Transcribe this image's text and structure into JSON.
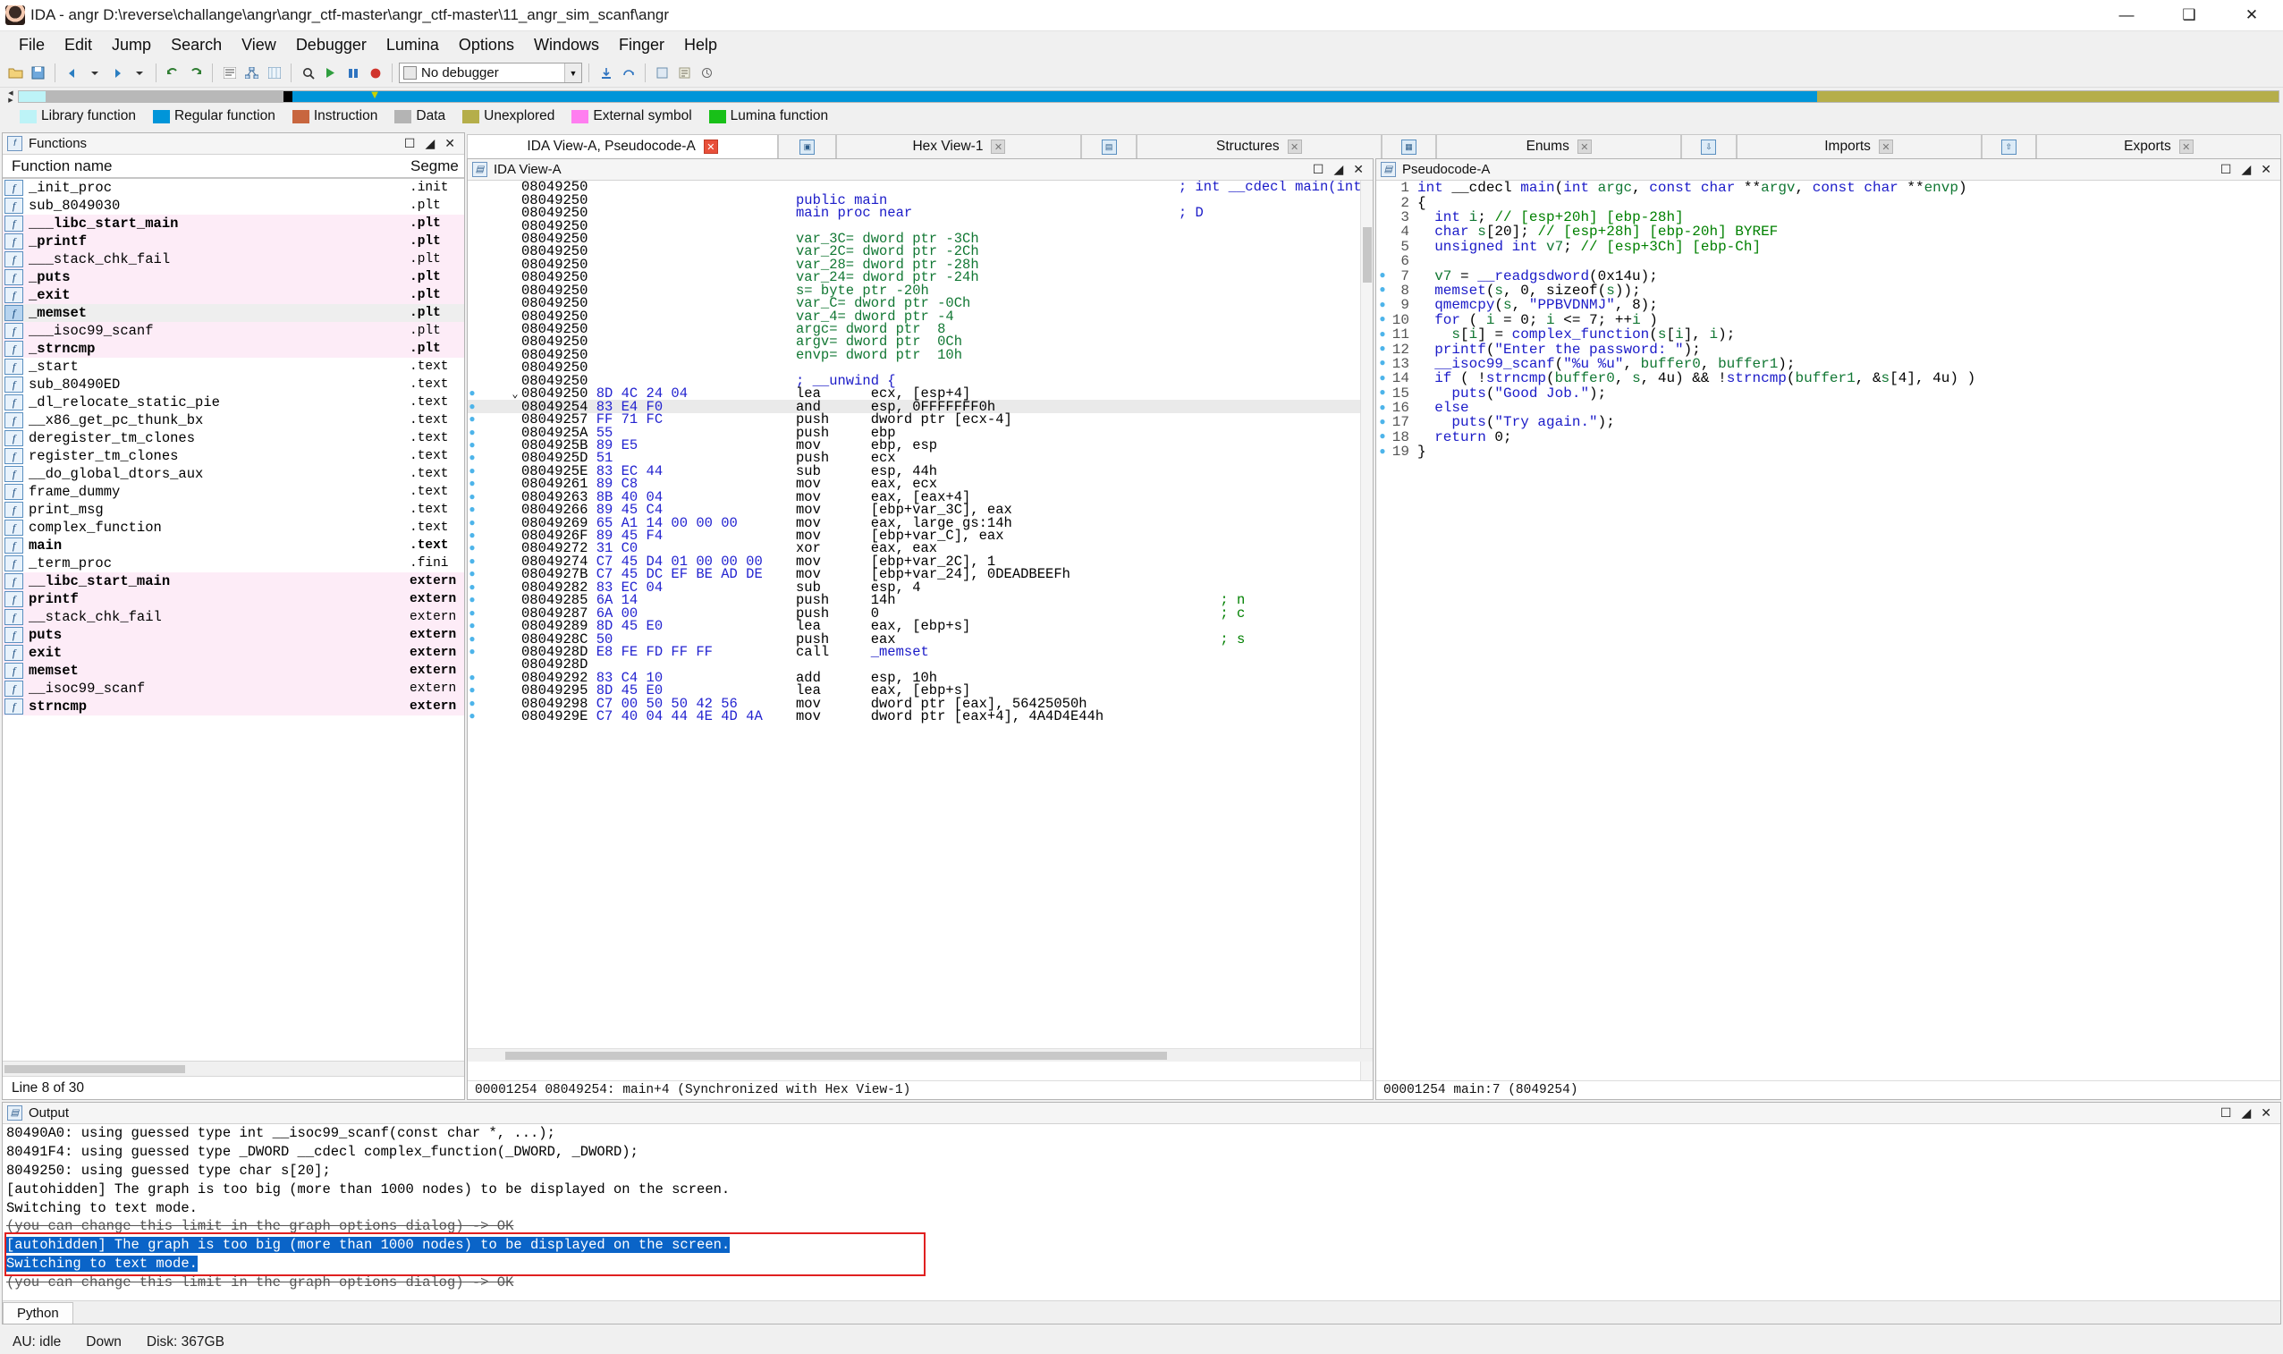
{
  "window": {
    "title": "IDA - angr D:\\reverse\\challange\\angr\\angr_ctf-master\\angr_ctf-master\\11_angr_sim_scanf\\angr",
    "minimize": "—",
    "maximize": "❑",
    "close": "✕"
  },
  "menu": [
    "File",
    "Edit",
    "Jump",
    "Search",
    "View",
    "Debugger",
    "Lumina",
    "Options",
    "Windows",
    "Finger",
    "Help"
  ],
  "toolbar": {
    "debugger_value": "No debugger",
    "icons": [
      "open-icon",
      "save-icon",
      "back-icon",
      "forward-icon",
      "undo-icon",
      "redo-icon",
      "text-view-icon",
      "graph-icon",
      "hex-icon",
      "search-icon",
      "run-icon",
      "pause-icon",
      "stop-icon"
    ]
  },
  "legend": [
    {
      "label": "Library function",
      "color": "#bdf3f7"
    },
    {
      "label": "Regular function",
      "color": "#0095d9"
    },
    {
      "label": "Instruction",
      "color": "#c8663f"
    },
    {
      "label": "Data",
      "color": "#b4b4b4"
    },
    {
      "label": "Unexplored",
      "color": "#b5ae4a"
    },
    {
      "label": "External symbol",
      "color": "#ff7ef0"
    },
    {
      "label": "Lumina function",
      "color": "#18c018"
    }
  ],
  "tabs_left": [
    {
      "label": "IDA View-A, Pseudocode-A",
      "closable": true,
      "active": true,
      "icon": null
    },
    {
      "label": "",
      "closable": false,
      "active": false,
      "icon": "window-icon"
    },
    {
      "label": "Hex View-1",
      "closable": true,
      "active": false,
      "icon": null
    },
    {
      "label": "",
      "closable": false,
      "active": false,
      "icon": "struct-icon"
    },
    {
      "label": "Structures",
      "closable": true,
      "active": false,
      "icon": null
    },
    {
      "label": "",
      "closable": false,
      "active": false,
      "icon": "enums-icon"
    },
    {
      "label": "Enums",
      "closable": true,
      "active": false,
      "icon": null
    },
    {
      "label": "",
      "closable": false,
      "active": false,
      "icon": "imports-icon"
    },
    {
      "label": "Imports",
      "closable": true,
      "active": false,
      "icon": null
    },
    {
      "label": "",
      "closable": false,
      "active": false,
      "icon": "exports-icon"
    },
    {
      "label": "Exports",
      "closable": true,
      "active": false,
      "icon": null
    }
  ],
  "functions_panel": {
    "title": "Functions",
    "columns": [
      "Function name",
      "Segme"
    ],
    "status": "Line 8 of 30",
    "rows": [
      {
        "name": "_init_proc",
        "segment": ".init",
        "lib": false,
        "selected": false,
        "bold": false
      },
      {
        "name": "sub_8049030",
        "segment": ".plt",
        "lib": false,
        "selected": false,
        "bold": false
      },
      {
        "name": "___libc_start_main",
        "segment": ".plt",
        "lib": true,
        "selected": false,
        "bold": true
      },
      {
        "name": "_printf",
        "segment": ".plt",
        "lib": true,
        "selected": false,
        "bold": true
      },
      {
        "name": "___stack_chk_fail",
        "segment": ".plt",
        "lib": true,
        "selected": false,
        "bold": false
      },
      {
        "name": "_puts",
        "segment": ".plt",
        "lib": true,
        "selected": false,
        "bold": true
      },
      {
        "name": "_exit",
        "segment": ".plt",
        "lib": true,
        "selected": false,
        "bold": true
      },
      {
        "name": "_memset",
        "segment": ".plt",
        "lib": true,
        "selected": true,
        "bold": true
      },
      {
        "name": "___isoc99_scanf",
        "segment": ".plt",
        "lib": true,
        "selected": false,
        "bold": false
      },
      {
        "name": "_strncmp",
        "segment": ".plt",
        "lib": true,
        "selected": false,
        "bold": true
      },
      {
        "name": "_start",
        "segment": ".text",
        "lib": false,
        "selected": false,
        "bold": false
      },
      {
        "name": "sub_80490ED",
        "segment": ".text",
        "lib": false,
        "selected": false,
        "bold": false
      },
      {
        "name": "_dl_relocate_static_pie",
        "segment": ".text",
        "lib": false,
        "selected": false,
        "bold": false
      },
      {
        "name": "__x86_get_pc_thunk_bx",
        "segment": ".text",
        "lib": false,
        "selected": false,
        "bold": false
      },
      {
        "name": "deregister_tm_clones",
        "segment": ".text",
        "lib": false,
        "selected": false,
        "bold": false
      },
      {
        "name": "register_tm_clones",
        "segment": ".text",
        "lib": false,
        "selected": false,
        "bold": false
      },
      {
        "name": "__do_global_dtors_aux",
        "segment": ".text",
        "lib": false,
        "selected": false,
        "bold": false
      },
      {
        "name": "frame_dummy",
        "segment": ".text",
        "lib": false,
        "selected": false,
        "bold": false
      },
      {
        "name": "print_msg",
        "segment": ".text",
        "lib": false,
        "selected": false,
        "bold": false
      },
      {
        "name": "complex_function",
        "segment": ".text",
        "lib": false,
        "selected": false,
        "bold": false
      },
      {
        "name": "main",
        "segment": ".text",
        "lib": false,
        "selected": false,
        "bold": true
      },
      {
        "name": "_term_proc",
        "segment": ".fini",
        "lib": false,
        "selected": false,
        "bold": false
      },
      {
        "name": "__libc_start_main",
        "segment": "extern",
        "lib": true,
        "selected": false,
        "bold": true
      },
      {
        "name": "printf",
        "segment": "extern",
        "lib": true,
        "selected": false,
        "bold": true
      },
      {
        "name": "__stack_chk_fail",
        "segment": "extern",
        "lib": true,
        "selected": false,
        "bold": false
      },
      {
        "name": "puts",
        "segment": "extern",
        "lib": true,
        "selected": false,
        "bold": true
      },
      {
        "name": "exit",
        "segment": "extern",
        "lib": true,
        "selected": false,
        "bold": true
      },
      {
        "name": "memset",
        "segment": "extern",
        "lib": true,
        "selected": false,
        "bold": true
      },
      {
        "name": "__isoc99_scanf",
        "segment": "extern",
        "lib": true,
        "selected": false,
        "bold": false
      },
      {
        "name": "strncmp",
        "segment": "extern",
        "lib": true,
        "selected": false,
        "bold": true
      }
    ]
  },
  "idaview": {
    "title": "IDA View-A",
    "status": "00001254 08049254: main+4 (Synchronized with Hex View-1)",
    "lines": [
      {
        "dot": false,
        "arrow": "",
        "addr": "08049250",
        "bytes": "",
        "mnem": "",
        "op": "",
        "cmt": "; int __cdecl main(int argc, const char **a",
        "cmt_color": "blue",
        "hl": false
      },
      {
        "dot": false,
        "arrow": "",
        "addr": "08049250",
        "bytes": "",
        "mnem": "public main",
        "op": "",
        "cmt": "",
        "mnem_color": "blue",
        "hl": false
      },
      {
        "dot": false,
        "arrow": "",
        "addr": "08049250",
        "bytes": "",
        "mnem": "main proc near",
        "op": "",
        "cmt": "; D",
        "mnem_color": "blue",
        "cmt_color": "blue",
        "hl": false
      },
      {
        "dot": false,
        "arrow": "",
        "addr": "08049250",
        "bytes": "",
        "mnem": "",
        "op": "",
        "cmt": "",
        "hl": false
      },
      {
        "dot": false,
        "arrow": "",
        "addr": "08049250",
        "bytes": "",
        "mnem": "var_3C= dword ptr -3Ch",
        "op": "",
        "cmt": "",
        "mnem_color": "green",
        "hl": false
      },
      {
        "dot": false,
        "arrow": "",
        "addr": "08049250",
        "bytes": "",
        "mnem": "var_2C= dword ptr -2Ch",
        "op": "",
        "cmt": "",
        "mnem_color": "green",
        "hl": false
      },
      {
        "dot": false,
        "arrow": "",
        "addr": "08049250",
        "bytes": "",
        "mnem": "var_28= dword ptr -28h",
        "op": "",
        "cmt": "",
        "mnem_color": "green",
        "hl": false
      },
      {
        "dot": false,
        "arrow": "",
        "addr": "08049250",
        "bytes": "",
        "mnem": "var_24= dword ptr -24h",
        "op": "",
        "cmt": "",
        "mnem_color": "green",
        "hl": false
      },
      {
        "dot": false,
        "arrow": "",
        "addr": "08049250",
        "bytes": "",
        "mnem": "s= byte ptr -20h",
        "op": "",
        "cmt": "",
        "mnem_color": "green",
        "hl": false
      },
      {
        "dot": false,
        "arrow": "",
        "addr": "08049250",
        "bytes": "",
        "mnem": "var_C= dword ptr -0Ch",
        "op": "",
        "cmt": "",
        "mnem_color": "green",
        "hl": false
      },
      {
        "dot": false,
        "arrow": "",
        "addr": "08049250",
        "bytes": "",
        "mnem": "var_4= dword ptr -4",
        "op": "",
        "cmt": "",
        "mnem_color": "green",
        "hl": false
      },
      {
        "dot": false,
        "arrow": "",
        "addr": "08049250",
        "bytes": "",
        "mnem": "argc= dword ptr  8",
        "op": "",
        "cmt": "",
        "mnem_color": "green",
        "hl": false
      },
      {
        "dot": false,
        "arrow": "",
        "addr": "08049250",
        "bytes": "",
        "mnem": "argv= dword ptr  0Ch",
        "op": "",
        "cmt": "",
        "mnem_color": "green",
        "hl": false
      },
      {
        "dot": false,
        "arrow": "",
        "addr": "08049250",
        "bytes": "",
        "mnem": "envp= dword ptr  10h",
        "op": "",
        "cmt": "",
        "mnem_color": "green",
        "hl": false
      },
      {
        "dot": false,
        "arrow": "",
        "addr": "08049250",
        "bytes": "",
        "mnem": "",
        "op": "",
        "cmt": "",
        "hl": false
      },
      {
        "dot": false,
        "arrow": "",
        "addr": "08049250",
        "bytes": "",
        "mnem": "; __unwind {",
        "op": "",
        "cmt": "",
        "mnem_color": "blue",
        "hl": false
      },
      {
        "dot": true,
        "arrow": "v",
        "addr": "08049250",
        "bytes": "8D 4C 24 04",
        "mnem": "lea",
        "op": "ecx, [esp+4]",
        "cmt": "",
        "hl": false
      },
      {
        "dot": true,
        "arrow": "",
        "addr": "08049254",
        "bytes": "83 E4 F0",
        "mnem": "and",
        "op": "esp, 0FFFFFFF0h",
        "cmt": "",
        "hl": true
      },
      {
        "dot": true,
        "arrow": "",
        "addr": "08049257",
        "bytes": "FF 71 FC",
        "mnem": "push",
        "op": "dword ptr [ecx-4]",
        "cmt": "",
        "hl": false
      },
      {
        "dot": true,
        "arrow": "",
        "addr": "0804925A",
        "bytes": "55",
        "mnem": "push",
        "op": "ebp",
        "cmt": "",
        "hl": false
      },
      {
        "dot": true,
        "arrow": "",
        "addr": "0804925B",
        "bytes": "89 E5",
        "mnem": "mov",
        "op": "ebp, esp",
        "cmt": "",
        "hl": false
      },
      {
        "dot": true,
        "arrow": "",
        "addr": "0804925D",
        "bytes": "51",
        "mnem": "push",
        "op": "ecx",
        "cmt": "",
        "hl": false
      },
      {
        "dot": true,
        "arrow": "",
        "addr": "0804925E",
        "bytes": "83 EC 44",
        "mnem": "sub",
        "op": "esp, 44h",
        "cmt": "",
        "hl": false
      },
      {
        "dot": true,
        "arrow": "",
        "addr": "08049261",
        "bytes": "89 C8",
        "mnem": "mov",
        "op": "eax, ecx",
        "cmt": "",
        "hl": false
      },
      {
        "dot": true,
        "arrow": "",
        "addr": "08049263",
        "bytes": "8B 40 04",
        "mnem": "mov",
        "op": "eax, [eax+4]",
        "cmt": "",
        "hl": false
      },
      {
        "dot": true,
        "arrow": "",
        "addr": "08049266",
        "bytes": "89 45 C4",
        "mnem": "mov",
        "op": "[ebp+var_3C], eax",
        "cmt": "",
        "hl": false
      },
      {
        "dot": true,
        "arrow": "",
        "addr": "08049269",
        "bytes": "65 A1 14 00 00 00",
        "mnem": "mov",
        "op": "eax, large gs:14h",
        "cmt": "",
        "hl": false
      },
      {
        "dot": true,
        "arrow": "",
        "addr": "0804926F",
        "bytes": "89 45 F4",
        "mnem": "mov",
        "op": "[ebp+var_C], eax",
        "cmt": "",
        "hl": false
      },
      {
        "dot": true,
        "arrow": "",
        "addr": "08049272",
        "bytes": "31 C0",
        "mnem": "xor",
        "op": "eax, eax",
        "cmt": "",
        "hl": false
      },
      {
        "dot": true,
        "arrow": "",
        "addr": "08049274",
        "bytes": "C7 45 D4 01 00 00 00",
        "mnem": "mov",
        "op": "[ebp+var_2C], 1",
        "cmt": "",
        "hl": false
      },
      {
        "dot": true,
        "arrow": "",
        "addr": "0804927B",
        "bytes": "C7 45 DC EF BE AD DE",
        "mnem": "mov",
        "op": "[ebp+var_24], 0DEADBEEFh",
        "cmt": "",
        "hl": false
      },
      {
        "dot": true,
        "arrow": "",
        "addr": "08049282",
        "bytes": "83 EC 04",
        "mnem": "sub",
        "op": "esp, 4",
        "cmt": "",
        "hl": false
      },
      {
        "dot": true,
        "arrow": "",
        "addr": "08049285",
        "bytes": "6A 14",
        "mnem": "push",
        "op": "14h",
        "cmt": "; n",
        "hl": false
      },
      {
        "dot": true,
        "arrow": "",
        "addr": "08049287",
        "bytes": "6A 00",
        "mnem": "push",
        "op": "0",
        "cmt": "; c",
        "hl": false
      },
      {
        "dot": true,
        "arrow": "",
        "addr": "08049289",
        "bytes": "8D 45 E0",
        "mnem": "lea",
        "op": "eax, [ebp+s]",
        "cmt": "",
        "hl": false
      },
      {
        "dot": true,
        "arrow": "",
        "addr": "0804928C",
        "bytes": "50",
        "mnem": "push",
        "op": "eax",
        "cmt": "; s",
        "hl": false
      },
      {
        "dot": true,
        "arrow": "",
        "addr": "0804928D",
        "bytes": "E8 FE FD FF FF",
        "mnem": "call",
        "op": "_memset",
        "cmt": "",
        "op_color": "blue",
        "hl": false
      },
      {
        "dot": false,
        "arrow": "",
        "addr": "0804928D",
        "bytes": "",
        "mnem": "",
        "op": "",
        "cmt": "",
        "hl": false
      },
      {
        "dot": true,
        "arrow": "",
        "addr": "08049292",
        "bytes": "83 C4 10",
        "mnem": "add",
        "op": "esp, 10h",
        "cmt": "",
        "hl": false
      },
      {
        "dot": true,
        "arrow": "",
        "addr": "08049295",
        "bytes": "8D 45 E0",
        "mnem": "lea",
        "op": "eax, [ebp+s]",
        "cmt": "",
        "hl": false
      },
      {
        "dot": true,
        "arrow": "",
        "addr": "08049298",
        "bytes": "C7 00 50 50 42 56",
        "mnem": "mov",
        "op": "dword ptr [eax], 56425050h",
        "cmt": "",
        "hl": false
      },
      {
        "dot": true,
        "arrow": "",
        "addr": "0804929E",
        "bytes": "C7 40 04 44 4E 4D 4A",
        "mnem": "mov",
        "op": "dword ptr [eax+4], 4A4D4E44h",
        "cmt": "",
        "hl": false
      }
    ]
  },
  "pseudocode": {
    "title": "Pseudocode-A",
    "status": "00001254 main:7 (8049254)",
    "lines": [
      {
        "n": 1,
        "dot": false,
        "text": "int __cdecl main(int argc, const char **argv, const char **envp)"
      },
      {
        "n": 2,
        "dot": false,
        "text": "{"
      },
      {
        "n": 3,
        "dot": false,
        "text": "  int i; // [esp+20h] [ebp-28h]"
      },
      {
        "n": 4,
        "dot": false,
        "text": "  char s[20]; // [esp+28h] [ebp-20h] BYREF"
      },
      {
        "n": 5,
        "dot": false,
        "text": "  unsigned int v7; // [esp+3Ch] [ebp-Ch]"
      },
      {
        "n": 6,
        "dot": false,
        "text": ""
      },
      {
        "n": 7,
        "dot": true,
        "text": "  v7 = __readgsdword(0x14u);"
      },
      {
        "n": 8,
        "dot": true,
        "text": "  memset(s, 0, sizeof(s));"
      },
      {
        "n": 9,
        "dot": true,
        "text": "  qmemcpy(s, \"PPBVDNMJ\", 8);"
      },
      {
        "n": 10,
        "dot": true,
        "text": "  for ( i = 0; i <= 7; ++i )"
      },
      {
        "n": 11,
        "dot": true,
        "text": "    s[i] = complex_function(s[i], i);"
      },
      {
        "n": 12,
        "dot": true,
        "text": "  printf(\"Enter the password: \");"
      },
      {
        "n": 13,
        "dot": true,
        "text": "  __isoc99_scanf(\"%u %u\", buffer0, buffer1);"
      },
      {
        "n": 14,
        "dot": true,
        "text": "  if ( !strncmp(buffer0, s, 4u) && !strncmp(buffer1, &s[4], 4u) )"
      },
      {
        "n": 15,
        "dot": true,
        "text": "    puts(\"Good Job.\");"
      },
      {
        "n": 16,
        "dot": true,
        "text": "  else"
      },
      {
        "n": 17,
        "dot": true,
        "text": "    puts(\"Try again.\");"
      },
      {
        "n": 18,
        "dot": true,
        "text": "  return 0;"
      },
      {
        "n": 19,
        "dot": true,
        "text": "}"
      }
    ]
  },
  "output": {
    "title": "Output",
    "tab": "Python",
    "lines": [
      {
        "text": "80490A0: using guessed type int __isoc99_scanf(const char *, ...);",
        "style": "clipped"
      },
      {
        "text": "80491F4: using guessed type _DWORD __cdecl complex_function(_DWORD, _DWORD);",
        "style": "normal"
      },
      {
        "text": "8049250: using guessed type char s[20];",
        "style": "normal"
      },
      {
        "text": "[autohidden] The graph is too big (more than 1000 nodes) to be displayed on the screen.",
        "style": "normal"
      },
      {
        "text": "Switching to text mode.",
        "style": "normal"
      },
      {
        "text": "(you can change this limit in the graph options dialog) -> OK",
        "style": "strike"
      },
      {
        "text": "[autohidden] The graph is too big (more than 1000 nodes) to be displayed on the screen.",
        "style": "selected"
      },
      {
        "text": "Switching to text mode.",
        "style": "selected"
      },
      {
        "text": "(you can change this limit in the graph options dialog) -> OK",
        "style": "strike"
      }
    ]
  },
  "statusbar": {
    "au": "AU: idle",
    "down": "Down",
    "disk": "Disk: 367GB"
  },
  "colors": {
    "accent": "#0095d9",
    "library_row": "#fdecf7",
    "selection": "#0a64c8",
    "highlight_box": "#e02020",
    "code_blue": "#1b1bc8",
    "code_green": "#117733"
  }
}
